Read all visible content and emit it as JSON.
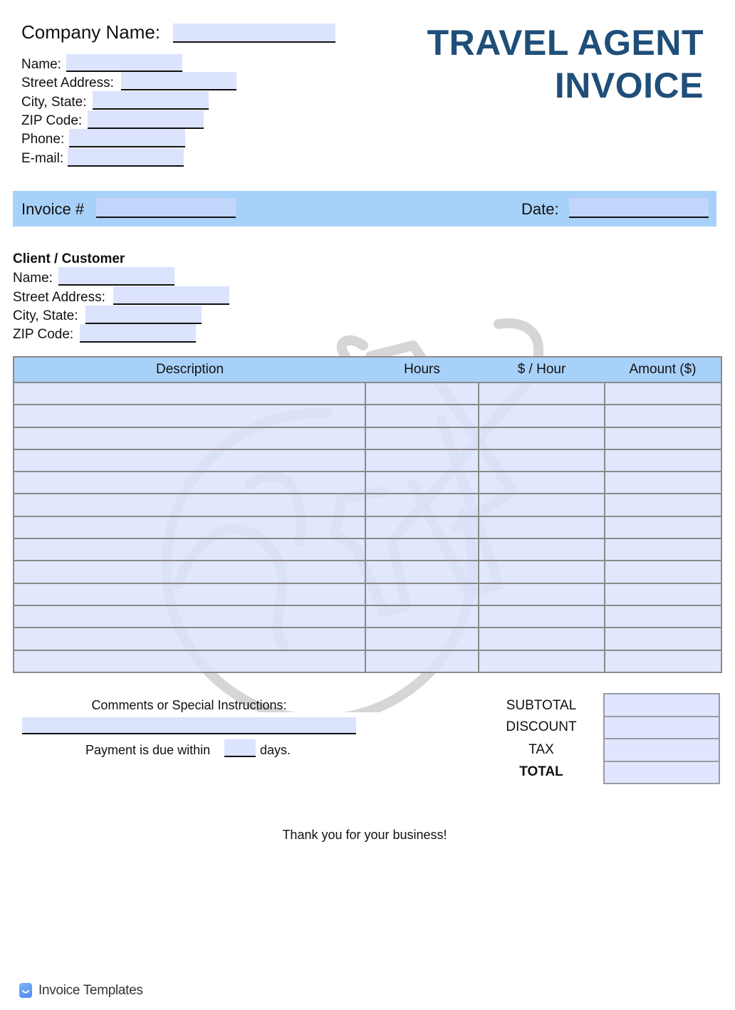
{
  "document": {
    "title_line1": "TRAVEL AGENT",
    "title_line2": "INVOICE",
    "title_color": "#1f4e79",
    "accent_band_color": "#a8d1f9",
    "field_fill_color": "#dce3fd"
  },
  "company": {
    "company_name_label": "Company Name:",
    "company_name_value": "",
    "fields": [
      {
        "label": "Name:",
        "value": ""
      },
      {
        "label": "Street Address:",
        "value": ""
      },
      {
        "label": "City, State:",
        "value": ""
      },
      {
        "label": "ZIP Code:",
        "value": ""
      },
      {
        "label": "Phone:",
        "value": ""
      },
      {
        "label": "E-mail:",
        "value": ""
      }
    ]
  },
  "invoice_band": {
    "invoice_label": "Invoice #",
    "invoice_value": "",
    "date_label": "Date:",
    "date_value": ""
  },
  "client": {
    "heading": "Client / Customer",
    "fields": [
      {
        "label": "Name:",
        "value": ""
      },
      {
        "label": "Street Address:",
        "value": ""
      },
      {
        "label": "City, State:",
        "value": ""
      },
      {
        "label": "ZIP Code:",
        "value": ""
      }
    ]
  },
  "items_table": {
    "columns": [
      "Description",
      "Hours",
      "$ / Hour",
      "Amount ($)"
    ],
    "row_count": 13,
    "rows": []
  },
  "comments": {
    "label": "Comments or Special Instructions:",
    "value": "",
    "payment_prefix": "Payment is due within",
    "payment_days": "",
    "payment_suffix": "days."
  },
  "totals": {
    "labels": [
      "SUBTOTAL",
      "DISCOUNT",
      "TAX",
      "TOTAL"
    ],
    "values": [
      "",
      "",
      "",
      ""
    ]
  },
  "thank_you": "Thank you for your business!",
  "footer": {
    "brand": "Invoice Templates",
    "logo_icon": "smile-badge-icon"
  }
}
